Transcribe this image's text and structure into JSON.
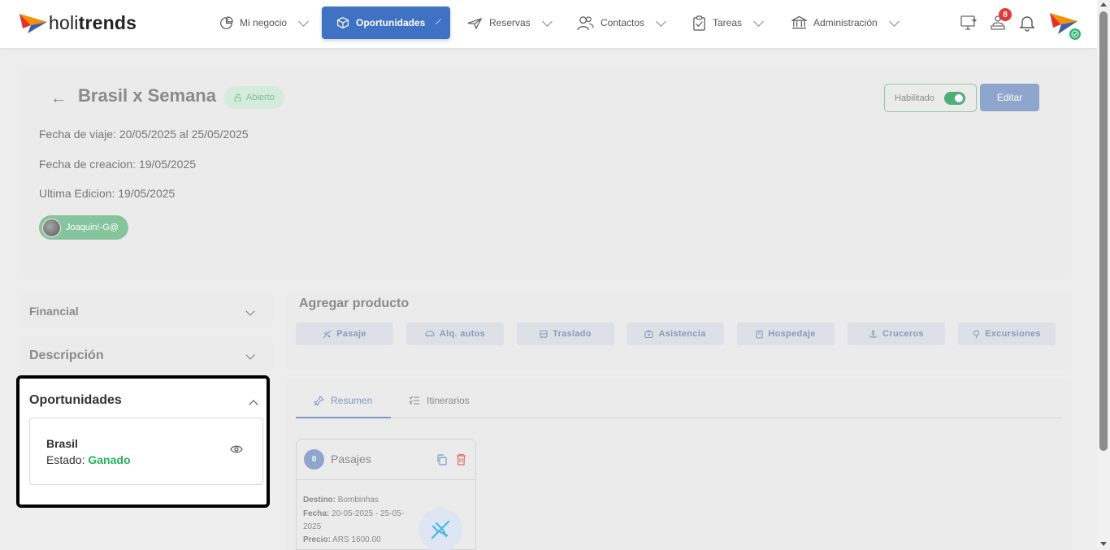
{
  "brand": {
    "logo_light": "holi",
    "logo_bold": "trends"
  },
  "nav": {
    "items": [
      {
        "label": "Mi negocio"
      },
      {
        "label": "Oportunidades"
      },
      {
        "label": "Reservas"
      },
      {
        "label": "Contactos"
      },
      {
        "label": "Tareas"
      },
      {
        "label": "Administración"
      }
    ],
    "notification_count": "8"
  },
  "header": {
    "back": "←",
    "title": "Brasil x Semana",
    "status": "Abierto",
    "travel_date": "Fecha de viaje: 20/05/2025 al 25/05/2025",
    "created_date": "Fecha de creacion: 19/05/2025",
    "edited_date": "Ultima Edicion: 19/05/2025",
    "user": "Joaquin!-G@",
    "toggle_label": "Habilitado",
    "toggle_on": true,
    "edit_label": "Editar"
  },
  "sidebar": {
    "financial": "Financial",
    "descripcion": "Descripción",
    "oportunidades": {
      "title": "Oportunidades",
      "item_name": "Brasil",
      "state_label": "Estado:",
      "state_value": "Ganado"
    }
  },
  "products": {
    "title": "Agregar producto",
    "buttons": [
      {
        "label": "Pasaje",
        "icon": "plane-icon"
      },
      {
        "label": "Alq. autos",
        "icon": "car-icon"
      },
      {
        "label": "Traslado",
        "icon": "bus-icon"
      },
      {
        "label": "Asistencia",
        "icon": "medkit-icon"
      },
      {
        "label": "Hospedaje",
        "icon": "hotel-icon"
      },
      {
        "label": "Cruceros",
        "icon": "anchor-icon"
      },
      {
        "label": "Excursiones",
        "icon": "pin-icon"
      }
    ]
  },
  "tabs": {
    "resumen": "Resumen",
    "itinerarios": "Itinerarios"
  },
  "pasajes": {
    "count": "0",
    "title": "Pasajes",
    "destino_label": "Destino:",
    "destino_value": "Bombinhas",
    "fecha_label": "Fecha:",
    "fecha_value_1": "20-05-2025 - 25-05-",
    "fecha_value_2": "2025",
    "precio_label": "Precio:",
    "precio_value": "ARS 1600.00"
  },
  "colors": {
    "primary": "#3f72c4",
    "success": "#22b35a",
    "badge": "#e03a3a"
  }
}
